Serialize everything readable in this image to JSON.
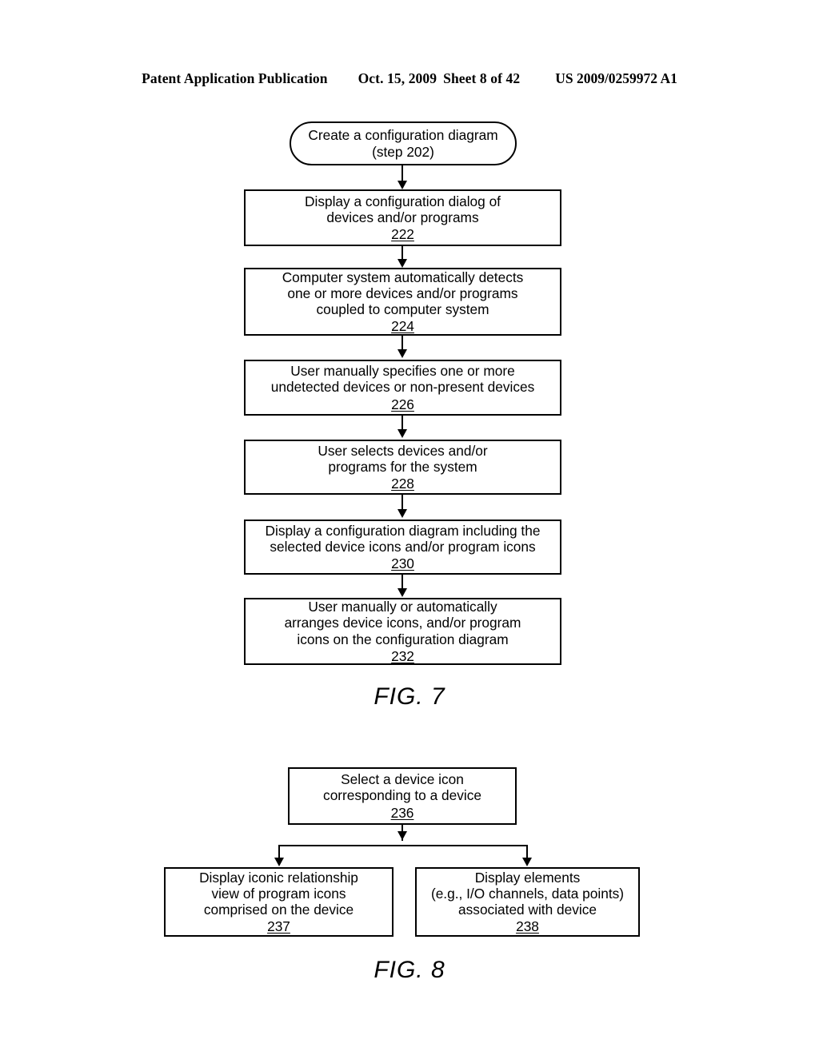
{
  "header": {
    "publication": "Patent Application Publication",
    "date": "Oct. 15, 2009",
    "sheet": "Sheet 8 of 42",
    "patent_number": "US 2009/0259972 A1"
  },
  "figure7": {
    "caption": "FIG. 7",
    "nodes": {
      "start": {
        "shape": "oval",
        "line1": "Create a configuration diagram",
        "line2": "(step 202)"
      },
      "step222": {
        "line1": "Display a configuration dialog of",
        "line2": "devices and/or programs",
        "ref": "222"
      },
      "step224": {
        "line1": "Computer system automatically detects",
        "line2": "one or more devices and/or programs",
        "line3": "coupled to computer system",
        "ref": "224"
      },
      "step226": {
        "line1": "User manually specifies one or more",
        "line2": "undetected devices or non-present devices",
        "ref": "226"
      },
      "step228": {
        "line1": "User selects devices and/or",
        "line2": "programs for the system",
        "ref": "228"
      },
      "step230": {
        "line1": "Display a configuration diagram including the",
        "line2": "selected device icons and/or program icons",
        "ref": "230"
      },
      "step232": {
        "line1": "User manually or automatically",
        "line2": "arranges device icons, and/or program",
        "line3": "icons on the configuration diagram",
        "ref": "232"
      }
    }
  },
  "figure8": {
    "caption": "FIG. 8",
    "nodes": {
      "step236": {
        "line1": "Select a device icon",
        "line2": "corresponding to a device",
        "ref": "236"
      },
      "step237": {
        "line1": "Display iconic relationship",
        "line2": "view of program icons",
        "line3": "comprised on the device",
        "ref": "237"
      },
      "step238": {
        "line1": "Display elements",
        "line2": "(e.g., I/O channels, data points)",
        "line3": "associated with device",
        "ref": "238"
      }
    }
  }
}
